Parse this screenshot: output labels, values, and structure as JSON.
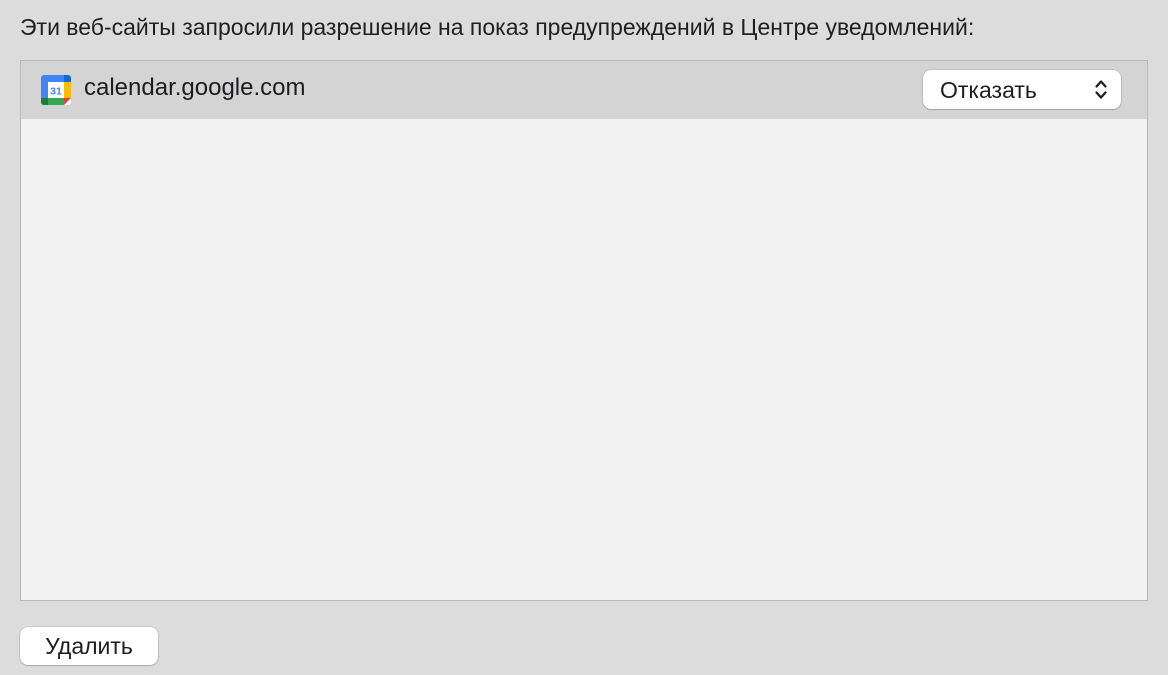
{
  "header": {
    "description": "Эти веб-сайты запросили разрешение на показ предупреждений в Центре уведомлений:"
  },
  "site_list": {
    "items": [
      {
        "domain": "calendar.google.com",
        "icon": "google-calendar-icon",
        "icon_text": "31",
        "permission": "Отказать",
        "selected": true
      }
    ]
  },
  "actions": {
    "remove_label": "Удалить"
  },
  "colors": {
    "window_background": "#dcdcdc",
    "list_background": "#f2f2f2",
    "selected_row": "#d4d4d4",
    "control_background": "#ffffff"
  }
}
